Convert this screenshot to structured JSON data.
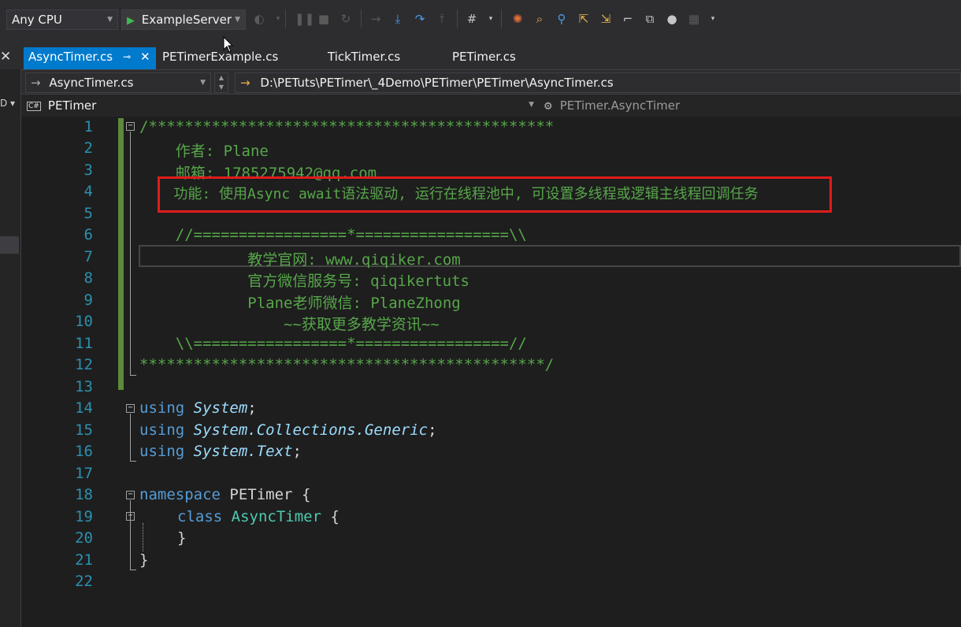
{
  "toolbar": {
    "platform_value": "Any CPU",
    "run_target_label": "ExampleServer"
  },
  "tabs": [
    {
      "label": "AsyncTimer.cs",
      "active": true
    },
    {
      "label": "PETimerExample.cs",
      "active": false
    },
    {
      "label": "TickTimer.cs",
      "active": false
    },
    {
      "label": "PETimer.cs",
      "active": false
    }
  ],
  "nav": {
    "file_combo": "AsyncTimer.cs",
    "file_path": "D:\\PETuts\\PETimer\\_4Demo\\PETimer\\PETimer\\AsyncTimer.cs",
    "project_combo": "PETimer",
    "project_badge": "C#",
    "member_combo": "PETimer.AsyncTimer"
  },
  "editor": {
    "line_numbers": [
      "1",
      "2",
      "3",
      "4",
      "5",
      "6",
      "7",
      "8",
      "9",
      "10",
      "11",
      "12",
      "13",
      "14",
      "15",
      "16",
      "17",
      "18",
      "19",
      "20",
      "21",
      "22"
    ],
    "lines": {
      "l1": "/*********************************************",
      "l2": "    作者: Plane",
      "l3": "    邮箱: 1785275942@qq.com",
      "l4": "    功能: 使用Async await语法驱动, 运行在线程池中, 可设置多线程或逻辑主线程回调任务",
      "l6": "    //=================*=================\\\\",
      "l7": "            教学官网: www.qiqiker.com",
      "l8": "            官方微信服务号: qiqikertuts",
      "l9": "            Plane老师微信: PlaneZhong",
      "l10": "                ~~获取更多教学资讯~~",
      "l11": "    \\\\=================*=================//",
      "l12": "*********************************************/",
      "l14_kw": "using",
      "l14_ns": "System",
      "l14_end": ";",
      "l15_kw": "using",
      "l15_ns": "System.Collections.Generic",
      "l15_end": ";",
      "l16_kw": "using",
      "l16_ns": "System.Text",
      "l16_end": ";",
      "l18_kw": "namespace",
      "l18_name": "PETimer",
      "l18_brace": "{",
      "l19_kw": "class",
      "l19_name": "AsyncTimer",
      "l19_brace": "{",
      "l20": "}",
      "l21": "}"
    }
  },
  "colors": {
    "accent": "#007acc",
    "comment": "#57a64a",
    "keyword": "#569cd6",
    "type": "#4ec9b0",
    "highlight_box": "#e01b1b"
  }
}
